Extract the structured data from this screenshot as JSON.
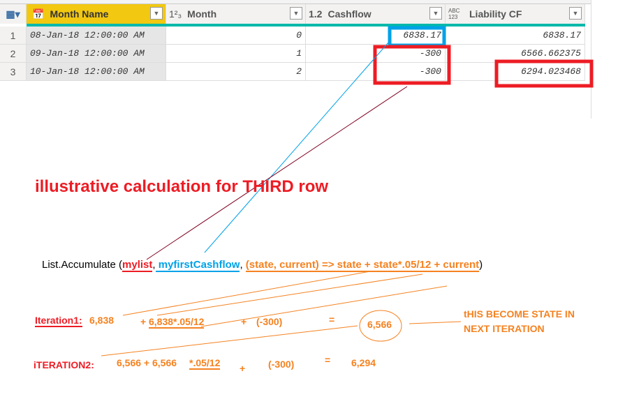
{
  "table": {
    "columns": [
      {
        "label": "Month Name",
        "type_icon": "calendar-clock-icon",
        "type": "datetime"
      },
      {
        "label": "Month",
        "type_icon": "123",
        "type": "whole-number"
      },
      {
        "label": "Cashflow",
        "type_icon": "1.2",
        "type": "decimal"
      },
      {
        "label": "Liability CF",
        "type_icon": "ABC 123",
        "type": "any"
      }
    ],
    "rows": [
      {
        "n": "1",
        "month_name": "08-Jan-18 12:00:00 AM",
        "month": "0",
        "cashflow": "6838.17",
        "liability": "6838.17"
      },
      {
        "n": "2",
        "month_name": "09-Jan-18 12:00:00 AM",
        "month": "1",
        "cashflow": "-300",
        "liability": "6566.662375"
      },
      {
        "n": "3",
        "month_name": "10-Jan-18 12:00:00 AM",
        "month": "2",
        "cashflow": "-300",
        "liability": "6294.023468"
      }
    ]
  },
  "annotation": {
    "title": "illustrative calculation for THIRD row",
    "formula_prefix": "List.Accumulate (",
    "arg1": "mylist",
    "comma1": ",",
    "arg2": " myfirstCashflow",
    "comma2": ", ",
    "arg3": "(state, current) => state + state*.05/12 + current",
    "formula_suffix": ")",
    "iter1_label": "Iteration1:",
    "iter1_state": " 6,838",
    "iter1_plus1": "+ ",
    "iter1_interest": "6,838*.05/12",
    "iter1_plus2": "+",
    "iter1_current": "(-300)",
    "iter1_eq": "=",
    "iter1_result": "6,566",
    "note_line1": "tHIS BECOME STATE IN",
    "note_line2": "NEXT ITERATION",
    "iter2_label": "iTERATION2:",
    "iter2_expr": "6,566 + 6,566 ",
    "iter2_interest": "*.05/12",
    "iter2_plus": "+",
    "iter2_current": "(-300)",
    "iter2_eq": "=",
    "iter2_result": "6,294"
  },
  "colors": {
    "red": "#ed1c24",
    "blue": "#00a2e8",
    "orange": "#f58220",
    "teal": "#01b8aa",
    "header_selected": "#f2c811"
  }
}
